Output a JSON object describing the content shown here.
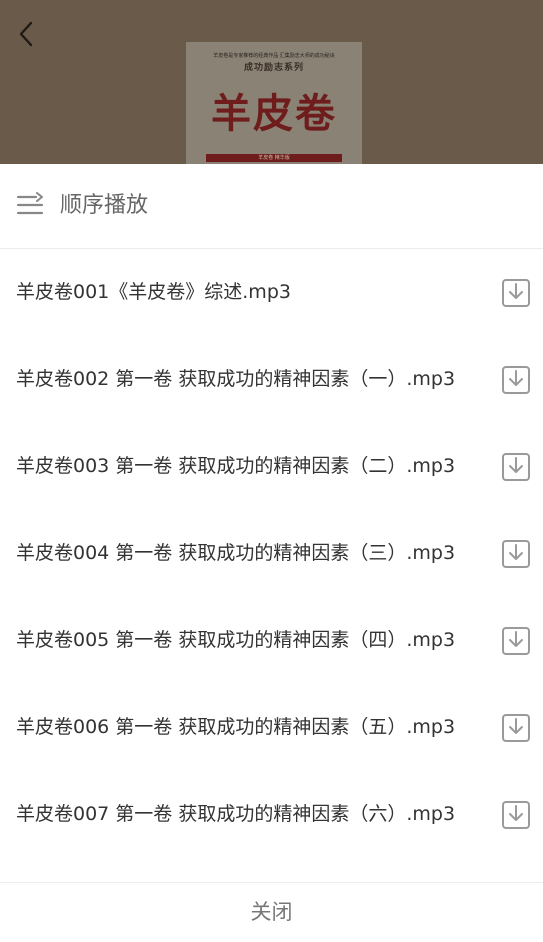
{
  "header": {
    "back_icon": "chevron-left-icon",
    "cover": {
      "top_text": "羊皮卷是专家推荐的经典作品 汇集励志大师的成功秘诀",
      "series": "成功励志系列",
      "title": "羊皮卷",
      "subtitle": "羊皮卷 精华版"
    }
  },
  "play_mode": {
    "icon": "sequential-play-icon",
    "label": "顺序播放"
  },
  "tracks": [
    {
      "title": "羊皮卷001《羊皮卷》综述.mp3",
      "icon": "download-icon"
    },
    {
      "title": "羊皮卷002 第一卷 获取成功的精神因素（一）.mp3",
      "icon": "download-icon"
    },
    {
      "title": "羊皮卷003 第一卷 获取成功的精神因素（二）.mp3",
      "icon": "download-icon"
    },
    {
      "title": "羊皮卷004 第一卷 获取成功的精神因素（三）.mp3",
      "icon": "download-icon"
    },
    {
      "title": "羊皮卷005 第一卷 获取成功的精神因素（四）.mp3",
      "icon": "download-icon"
    },
    {
      "title": "羊皮卷006 第一卷 获取成功的精神因素（五）.mp3",
      "icon": "download-icon"
    },
    {
      "title": "羊皮卷007 第一卷 获取成功的精神因素（六）.mp3",
      "icon": "download-icon"
    }
  ],
  "close_label": "关闭",
  "colors": {
    "overlay": "#6a5a4a",
    "text_primary": "#333333",
    "text_secondary": "#666666",
    "icon_gray": "#9a9a9a"
  }
}
